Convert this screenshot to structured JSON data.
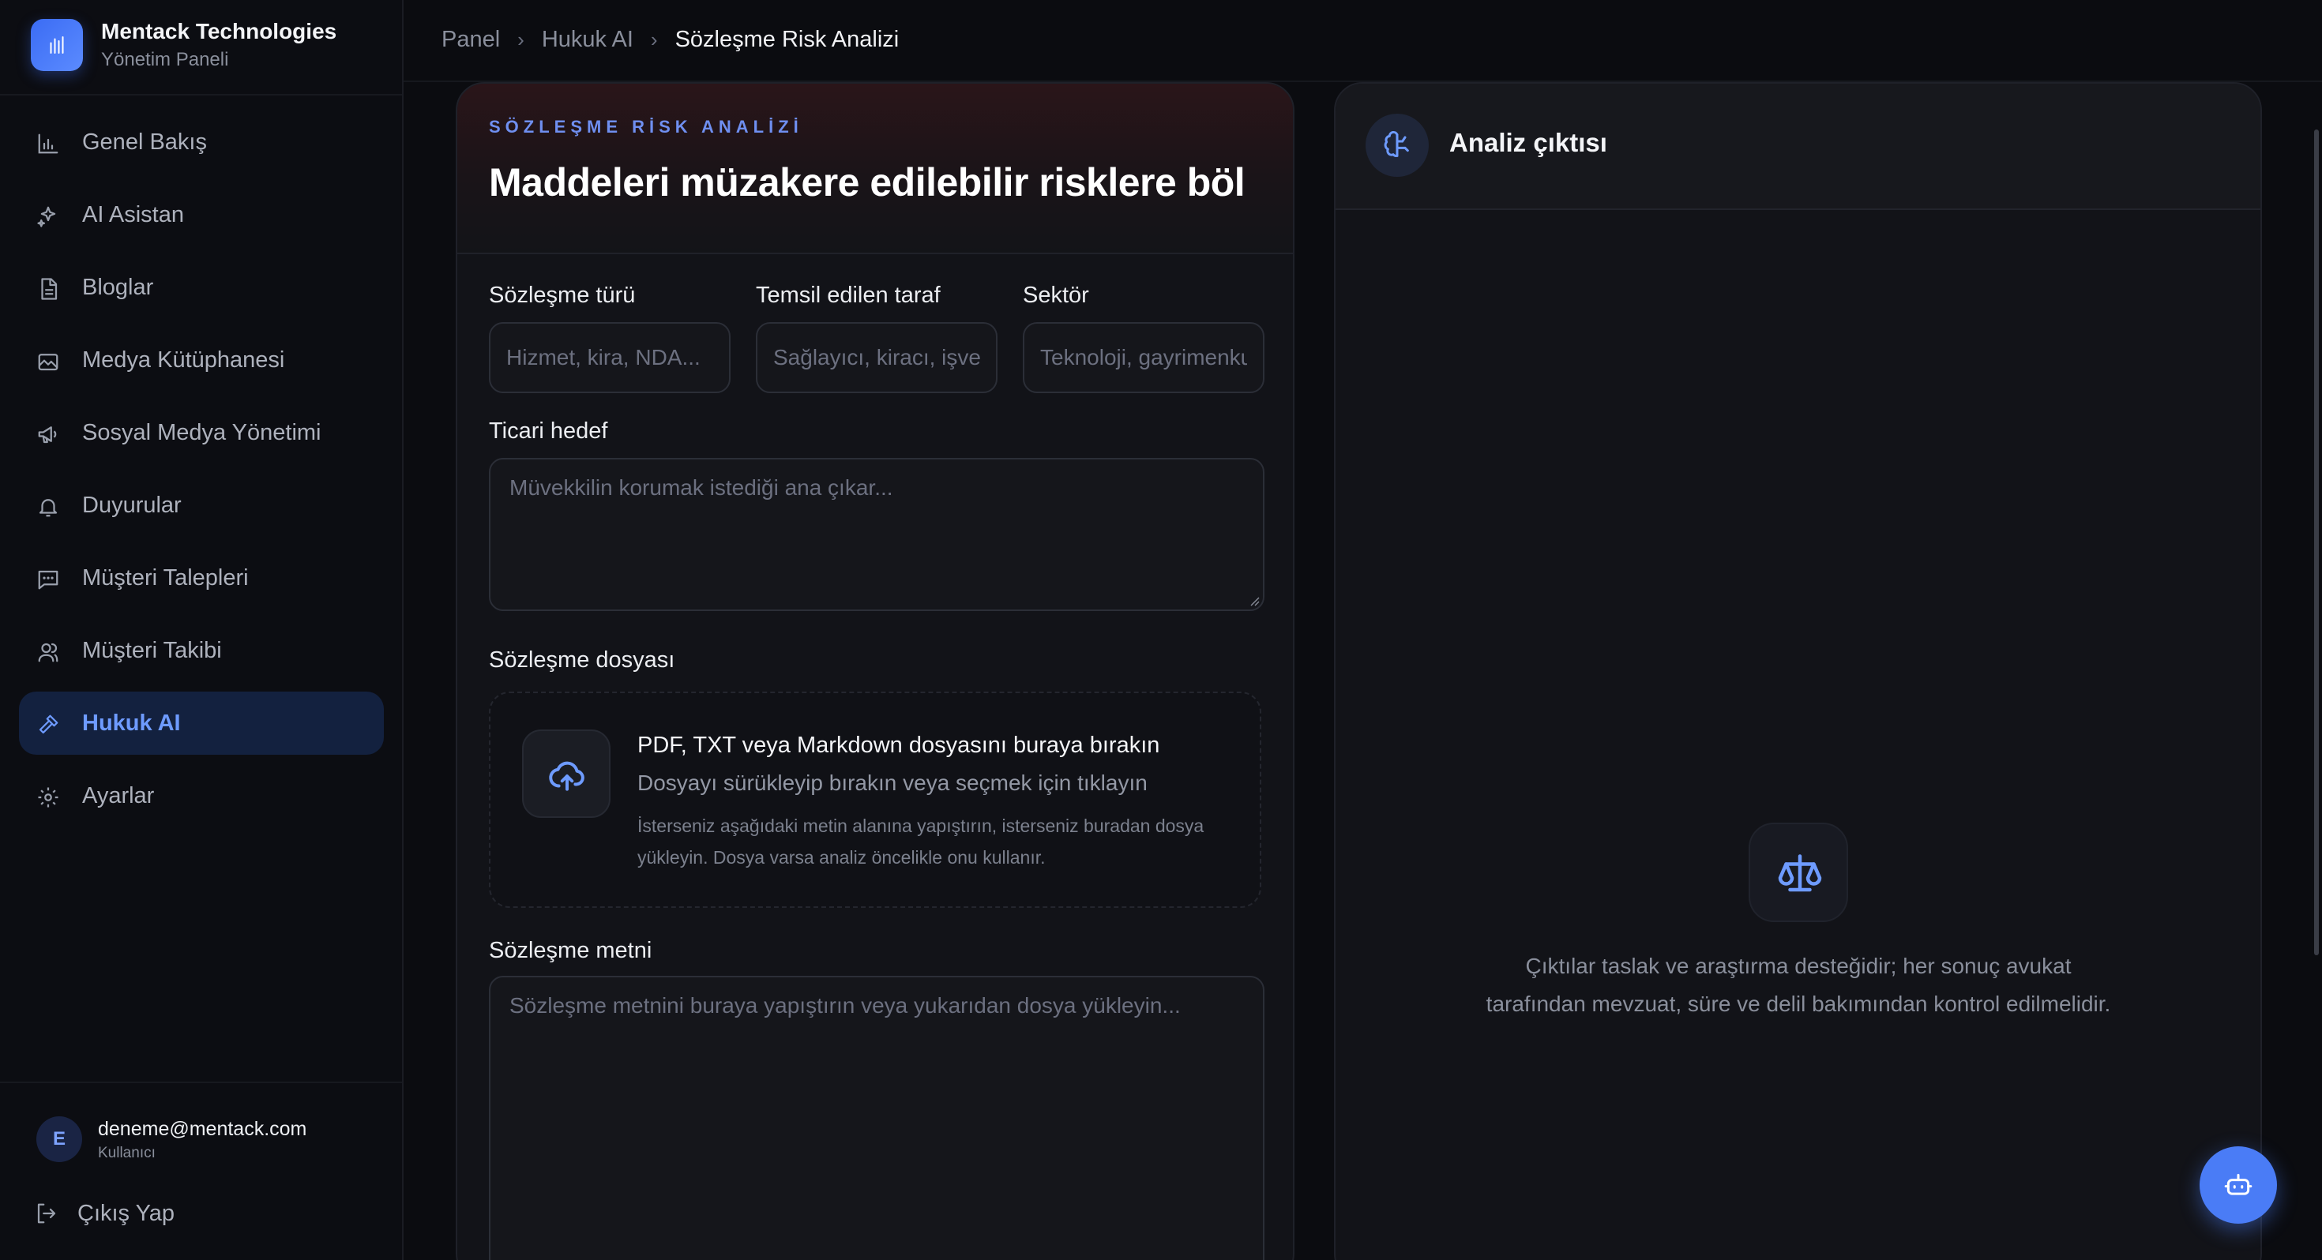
{
  "brand": {
    "name": "Mentack Technologies",
    "subtitle": "Yönetim Paneli"
  },
  "sidebar": {
    "items": [
      {
        "label": "Genel Bakış",
        "icon": "bar-chart-icon"
      },
      {
        "label": "AI Asistan",
        "icon": "sparkles-icon"
      },
      {
        "label": "Bloglar",
        "icon": "document-icon"
      },
      {
        "label": "Medya Kütüphanesi",
        "icon": "image-icon"
      },
      {
        "label": "Sosyal Medya Yönetimi",
        "icon": "megaphone-icon"
      },
      {
        "label": "Duyurular",
        "icon": "bell-icon"
      },
      {
        "label": "Müşteri Talepleri",
        "icon": "message-icon"
      },
      {
        "label": "Müşteri Takibi",
        "icon": "users-icon"
      },
      {
        "label": "Hukuk AI",
        "icon": "gavel-icon",
        "active": true
      },
      {
        "label": "Ayarlar",
        "icon": "gear-icon"
      }
    ]
  },
  "user": {
    "initial": "E",
    "email": "deneme@mentack.com",
    "role": "Kullanıcı",
    "logout_label": "Çıkış Yap"
  },
  "breadcrumb": {
    "items": [
      "Panel",
      "Hukuk AI",
      "Sözleşme Risk Analizi"
    ]
  },
  "form": {
    "eyebrow": "SÖZLEŞME RİSK ANALİZİ",
    "title": "Maddeleri müzakere edilebilir risklere böl",
    "contract_type": {
      "label": "Sözleşme türü",
      "placeholder": "Hizmet, kira, NDA...",
      "value": ""
    },
    "party": {
      "label": "Temsil edilen taraf",
      "placeholder": "Sağlayıcı, kiracı, işveren...",
      "value": ""
    },
    "sector": {
      "label": "Sektör",
      "placeholder": "Teknoloji, gayrimenkul...",
      "value": ""
    },
    "goal": {
      "label": "Ticari hedef",
      "placeholder": "Müvekkilin korumak istediği ana çıkar...",
      "value": ""
    },
    "file": {
      "label": "Sözleşme dosyası",
      "title": "PDF, TXT veya Markdown dosyasını buraya bırakın",
      "subtitle": "Dosyayı sürükleyip bırakın veya seçmek için tıklayın",
      "note": "İsterseniz aşağıdaki metin alanına yapıştırın, isterseniz buradan dosya yükleyin. Dosya varsa analiz öncelikle onu kullanır."
    },
    "text": {
      "label": "Sözleşme metni",
      "placeholder": "Sözleşme metnini buraya yapıştırın veya yukarıdan dosya yükleyin...",
      "value": ""
    }
  },
  "output": {
    "title": "Analiz çıktısı",
    "empty_text": "Çıktılar taslak ve araştırma desteğidir; her sonuç avukat tarafından mevzuat, süre ve delil bakımından kontrol edilmelidir."
  },
  "colors": {
    "accent": "#4a7cf6",
    "active_bg": "#13213f",
    "active_text": "#6e9bff",
    "background": "#0b0c10"
  }
}
